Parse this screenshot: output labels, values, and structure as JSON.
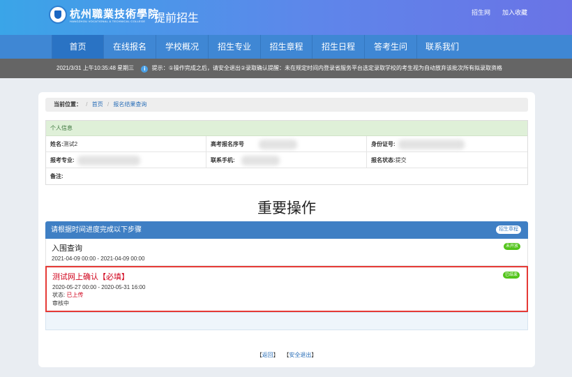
{
  "header": {
    "school_name_cn": "杭州職業技術學院",
    "school_name_en": "HANGZHOU VOCATIONAL & TECHNICAL COLLEGE",
    "site_title": "提前招生",
    "links": [
      "招生网",
      "加入收藏"
    ]
  },
  "nav": {
    "items": [
      "首页",
      "在线报名",
      "学校概况",
      "招生专业",
      "招生章程",
      "招生日程",
      "答考生问",
      "联系我们"
    ]
  },
  "notice": {
    "datetime": "2021/3/31 上午10:35:48 星期三",
    "text": "提示：①操作完成之后，请安全退出②录取确认提醒：未在规定时间内登录省服务平台选定录取学校的考生视为自动放弃该批次所有拟录取资格"
  },
  "breadcrumb": {
    "label": "当前位置：",
    "items": [
      "首页",
      "报名结果查询"
    ]
  },
  "personal_info": {
    "heading": "个人信息",
    "name_label": "姓名:",
    "name_value": "测试2",
    "exam_no_label": "高考报名序号",
    "id_label": "身份证号:",
    "major_label": "报考专业:",
    "phone_label": "联系手机:",
    "status_label": "报名状态:",
    "status_value": "提交",
    "note_label": "备注:"
  },
  "section_title": "重要操作",
  "steps": {
    "heading": "请根据时间进度完成以下步骤",
    "rules_button": "招生章程",
    "items": [
      {
        "name": "入围查询",
        "date": "2021-04-09 00:00 - 2021-04-09 00:00",
        "tag": "未开放"
      },
      {
        "name": "测试网上确认【必填】",
        "date": "2020-05-27 00:00 - 2020-05-31 16:00",
        "status_label": "状态:",
        "status_value": "已上传",
        "review": "审核中",
        "tag": "已结束"
      }
    ]
  },
  "footer_links": {
    "back": "返回",
    "logout": "安全退出"
  }
}
